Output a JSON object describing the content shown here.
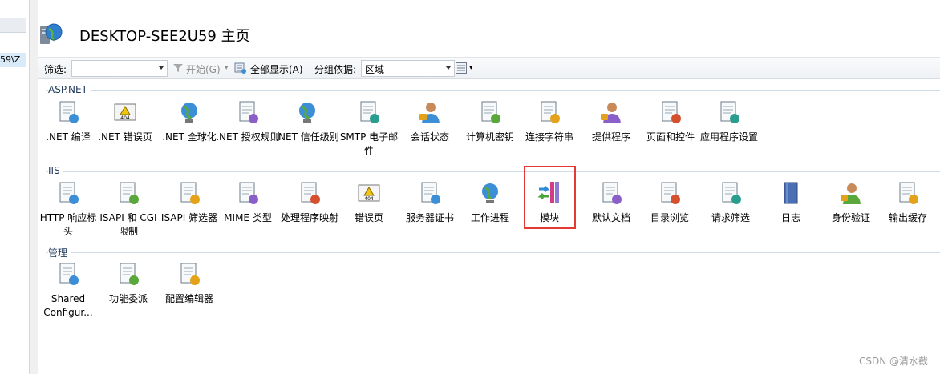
{
  "left_tree": {
    "selected_text": "59\\Z"
  },
  "header": {
    "title": "DESKTOP-SEE2U59 主页"
  },
  "toolbar": {
    "filter_label": "筛选:",
    "filter_value": "",
    "start_label": "开始(G)",
    "show_all_label": "全部显示(A)",
    "group_by_label": "分组依据:",
    "group_by_value": "区域"
  },
  "sections": [
    {
      "name": "ASP.NET",
      "items": [
        {
          "label": ".NET 编译",
          "icon": "net-compilation-icon"
        },
        {
          "label": ".NET 错误页",
          "icon": "net-error-pages-icon"
        },
        {
          "label": ".NET 全球化",
          "icon": "net-globalization-icon"
        },
        {
          "label": ".NET 授权规则",
          "icon": "net-authorization-rules-icon"
        },
        {
          "label": ".NET 信任级别",
          "icon": "net-trust-levels-icon"
        },
        {
          "label": "SMTP 电子邮件",
          "icon": "smtp-email-icon"
        },
        {
          "label": "会话状态",
          "icon": "session-state-icon"
        },
        {
          "label": "计算机密钥",
          "icon": "machine-key-icon"
        },
        {
          "label": "连接字符串",
          "icon": "connection-strings-icon"
        },
        {
          "label": "提供程序",
          "icon": "providers-icon"
        },
        {
          "label": "页面和控件",
          "icon": "pages-and-controls-icon"
        },
        {
          "label": "应用程序设置",
          "icon": "application-settings-icon"
        }
      ]
    },
    {
      "name": "IIS",
      "items": [
        {
          "label": "HTTP 响应标头",
          "icon": "http-response-headers-icon"
        },
        {
          "label": "ISAPI 和 CGI 限制",
          "icon": "isapi-cgi-restrictions-icon"
        },
        {
          "label": "ISAPI 筛选器",
          "icon": "isapi-filters-icon"
        },
        {
          "label": "MIME 类型",
          "icon": "mime-types-icon"
        },
        {
          "label": "处理程序映射",
          "icon": "handler-mappings-icon"
        },
        {
          "label": "错误页",
          "icon": "error-pages-icon"
        },
        {
          "label": "服务器证书",
          "icon": "server-certificates-icon"
        },
        {
          "label": "工作进程",
          "icon": "worker-processes-icon"
        },
        {
          "label": "模块",
          "icon": "modules-icon"
        },
        {
          "label": "默认文档",
          "icon": "default-document-icon"
        },
        {
          "label": "目录浏览",
          "icon": "directory-browsing-icon"
        },
        {
          "label": "请求筛选",
          "icon": "request-filtering-icon"
        },
        {
          "label": "日志",
          "icon": "logging-icon"
        },
        {
          "label": "身份验证",
          "icon": "authentication-icon"
        },
        {
          "label": "输出缓存",
          "icon": "output-caching-icon"
        }
      ]
    },
    {
      "name": "管理",
      "items": [
        {
          "label": "Shared Configur...",
          "icon": "shared-configuration-icon"
        },
        {
          "label": "功能委派",
          "icon": "feature-delegation-icon"
        },
        {
          "label": "配置编辑器",
          "icon": "configuration-editor-icon"
        }
      ]
    }
  ],
  "watermark": "CSDN @清水截",
  "colors": {
    "section_text": "#1e395b",
    "highlight": "#e53935",
    "selection": "#d9ebf9"
  }
}
